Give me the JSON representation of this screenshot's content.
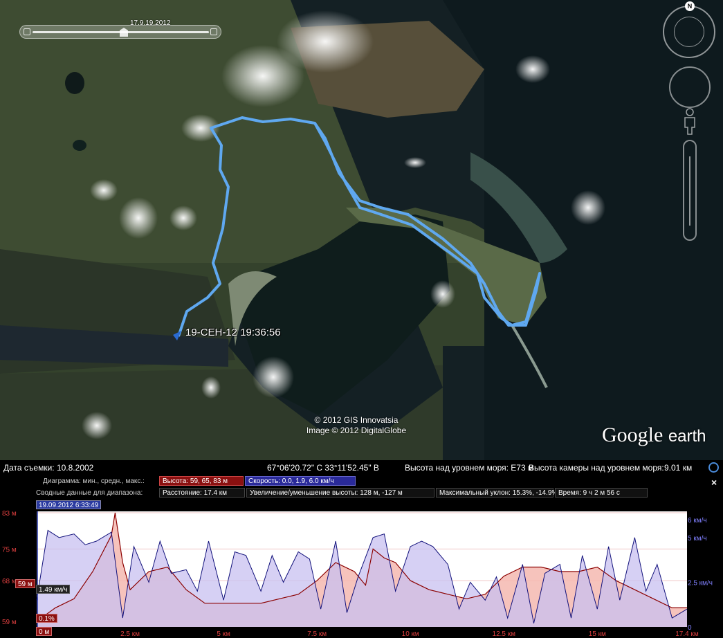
{
  "map": {
    "time_slider_label": "17.9.19.2012",
    "compass_north": "N",
    "track_label": "19-СЕН-12 19:36:56",
    "copyright_line1": "© 2012 GIS Innovatsia",
    "copyright_line2": "Image © 2012 DigitalGlobe",
    "logo_main": "Google",
    "logo_sub": "earth",
    "track_color": "#5fa8f0"
  },
  "status": {
    "imagery_date": "Дата съемки: 10.8.2002",
    "coordinates": "67°06'20.72\" С  33°11'52.45\" В",
    "elevation": "Высота над уровнем моря:   Е73 м",
    "camera": "Высота камеры над уровнем моря:",
    "camera_value": "9.01 км"
  },
  "profile": {
    "row1_label": "Диаграмма: мин., средн., макс.:",
    "altitude_box": "Высота: 59, 65, 83 м",
    "speed_box": "Скорость: 0.0, 1.9, 6.0 км/ч",
    "row2_label": "Сводные данные для диапазона:",
    "distance_box": "Расстояние: 17.4 км",
    "gain_box": "Увеличение/уменьшение высоты: 128 м, -127 м",
    "slope_box": "Максимальный уклон: 15.3%, -14.9%",
    "time_box": "Время: 9 ч 2 м 56 с",
    "close": "×",
    "cursor_time": "19.09.2012 6:33:49",
    "cursor_alt": "59 м",
    "cursor_speed": "1.49 км/ч",
    "cursor_slope": "0.1%",
    "cursor_dist": "0 м",
    "colors": {
      "altitude_line": "#8b0000",
      "altitude_fill": "#f4b8b0",
      "speed_line": "#10107a",
      "speed_fill": "#c8c0f0"
    }
  },
  "chart_data": {
    "type": "area",
    "xlabel": "",
    "x_ticks": [
      "2.5 км",
      "5 км",
      "7.5 км",
      "10 км",
      "12.5 км",
      "15 км",
      "17.4 км"
    ],
    "y_left_ticks": [
      "83 м",
      "75 м",
      "68 м",
      "59 м"
    ],
    "y_right_ticks": [
      "6 км/ч",
      "5 км/ч",
      "2.5 км/ч",
      "0"
    ],
    "xlim": [
      0,
      17.4
    ],
    "ylim_left": [
      59,
      83
    ],
    "ylim_right": [
      0,
      6
    ],
    "series": [
      {
        "name": "Высота",
        "x": [
          0,
          0.5,
          1.0,
          1.5,
          2.0,
          2.1,
          2.3,
          2.5,
          3.0,
          3.5,
          4.0,
          4.5,
          5.0,
          5.5,
          6.0,
          6.5,
          7.0,
          7.5,
          8.0,
          8.5,
          8.8,
          9.0,
          9.3,
          9.6,
          10.0,
          10.5,
          11.0,
          11.5,
          12.0,
          12.5,
          13.0,
          13.5,
          14.0,
          14.5,
          15.0,
          15.5,
          16.0,
          16.5,
          17.0,
          17.4
        ],
        "values": [
          59,
          62,
          64,
          70,
          78,
          83,
          72,
          66,
          70,
          71,
          66,
          63,
          63,
          63,
          63,
          64,
          65,
          68,
          72,
          70,
          67,
          75,
          73,
          72,
          68,
          66,
          65,
          64,
          65,
          69,
          71,
          71,
          70,
          70,
          71,
          68,
          66,
          64,
          62,
          62
        ]
      },
      {
        "name": "Скорость",
        "x": [
          0,
          0.3,
          0.6,
          1.0,
          1.3,
          1.6,
          2.0,
          2.3,
          2.6,
          3.0,
          3.3,
          3.6,
          4.0,
          4.3,
          4.6,
          5.0,
          5.3,
          5.6,
          6.0,
          6.3,
          6.6,
          7.0,
          7.3,
          7.6,
          8.0,
          8.3,
          8.6,
          9.0,
          9.3,
          9.6,
          10.0,
          10.3,
          10.6,
          11.0,
          11.3,
          11.6,
          12.0,
          12.3,
          12.6,
          13.0,
          13.3,
          13.6,
          14.0,
          14.3,
          14.6,
          15.0,
          15.3,
          15.6,
          16.0,
          16.3,
          16.6,
          17.0,
          17.4
        ],
        "values": [
          1.5,
          5.4,
          5.0,
          5.2,
          4.6,
          4.8,
          5.3,
          0.5,
          4.5,
          2.5,
          4.8,
          3.0,
          3.2,
          2.0,
          4.8,
          1.5,
          4.2,
          4.0,
          2.0,
          4.0,
          2.5,
          4.2,
          3.8,
          1.0,
          4.8,
          0.8,
          2.8,
          5.0,
          5.2,
          2.0,
          4.5,
          4.8,
          4.5,
          3.5,
          1.0,
          2.5,
          1.5,
          2.8,
          0.5,
          3.5,
          0.2,
          3.0,
          3.5,
          0.5,
          4.0,
          1.0,
          4.5,
          1.5,
          5.0,
          2.0,
          3.5,
          0.5,
          1.0
        ]
      }
    ]
  }
}
